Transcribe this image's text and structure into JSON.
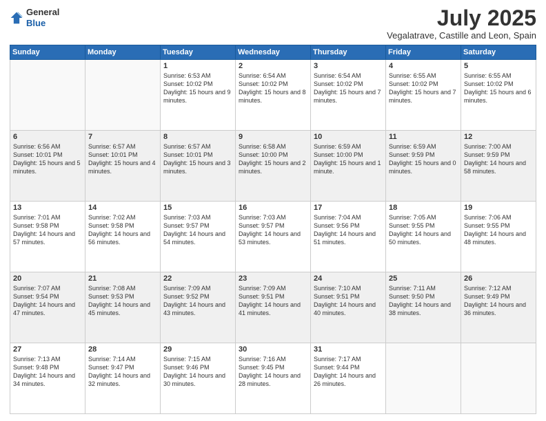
{
  "header": {
    "logo_line1": "General",
    "logo_line2": "Blue",
    "month": "July 2025",
    "location": "Vegalatrave, Castille and Leon, Spain"
  },
  "weekdays": [
    "Sunday",
    "Monday",
    "Tuesday",
    "Wednesday",
    "Thursday",
    "Friday",
    "Saturday"
  ],
  "weeks": [
    [
      {
        "day": "",
        "info": ""
      },
      {
        "day": "",
        "info": ""
      },
      {
        "day": "1",
        "info": "Sunrise: 6:53 AM\nSunset: 10:02 PM\nDaylight: 15 hours and 9 minutes."
      },
      {
        "day": "2",
        "info": "Sunrise: 6:54 AM\nSunset: 10:02 PM\nDaylight: 15 hours and 8 minutes."
      },
      {
        "day": "3",
        "info": "Sunrise: 6:54 AM\nSunset: 10:02 PM\nDaylight: 15 hours and 7 minutes."
      },
      {
        "day": "4",
        "info": "Sunrise: 6:55 AM\nSunset: 10:02 PM\nDaylight: 15 hours and 7 minutes."
      },
      {
        "day": "5",
        "info": "Sunrise: 6:55 AM\nSunset: 10:02 PM\nDaylight: 15 hours and 6 minutes."
      }
    ],
    [
      {
        "day": "6",
        "info": "Sunrise: 6:56 AM\nSunset: 10:01 PM\nDaylight: 15 hours and 5 minutes."
      },
      {
        "day": "7",
        "info": "Sunrise: 6:57 AM\nSunset: 10:01 PM\nDaylight: 15 hours and 4 minutes."
      },
      {
        "day": "8",
        "info": "Sunrise: 6:57 AM\nSunset: 10:01 PM\nDaylight: 15 hours and 3 minutes."
      },
      {
        "day": "9",
        "info": "Sunrise: 6:58 AM\nSunset: 10:00 PM\nDaylight: 15 hours and 2 minutes."
      },
      {
        "day": "10",
        "info": "Sunrise: 6:59 AM\nSunset: 10:00 PM\nDaylight: 15 hours and 1 minute."
      },
      {
        "day": "11",
        "info": "Sunrise: 6:59 AM\nSunset: 9:59 PM\nDaylight: 15 hours and 0 minutes."
      },
      {
        "day": "12",
        "info": "Sunrise: 7:00 AM\nSunset: 9:59 PM\nDaylight: 14 hours and 58 minutes."
      }
    ],
    [
      {
        "day": "13",
        "info": "Sunrise: 7:01 AM\nSunset: 9:58 PM\nDaylight: 14 hours and 57 minutes."
      },
      {
        "day": "14",
        "info": "Sunrise: 7:02 AM\nSunset: 9:58 PM\nDaylight: 14 hours and 56 minutes."
      },
      {
        "day": "15",
        "info": "Sunrise: 7:03 AM\nSunset: 9:57 PM\nDaylight: 14 hours and 54 minutes."
      },
      {
        "day": "16",
        "info": "Sunrise: 7:03 AM\nSunset: 9:57 PM\nDaylight: 14 hours and 53 minutes."
      },
      {
        "day": "17",
        "info": "Sunrise: 7:04 AM\nSunset: 9:56 PM\nDaylight: 14 hours and 51 minutes."
      },
      {
        "day": "18",
        "info": "Sunrise: 7:05 AM\nSunset: 9:55 PM\nDaylight: 14 hours and 50 minutes."
      },
      {
        "day": "19",
        "info": "Sunrise: 7:06 AM\nSunset: 9:55 PM\nDaylight: 14 hours and 48 minutes."
      }
    ],
    [
      {
        "day": "20",
        "info": "Sunrise: 7:07 AM\nSunset: 9:54 PM\nDaylight: 14 hours and 47 minutes."
      },
      {
        "day": "21",
        "info": "Sunrise: 7:08 AM\nSunset: 9:53 PM\nDaylight: 14 hours and 45 minutes."
      },
      {
        "day": "22",
        "info": "Sunrise: 7:09 AM\nSunset: 9:52 PM\nDaylight: 14 hours and 43 minutes."
      },
      {
        "day": "23",
        "info": "Sunrise: 7:09 AM\nSunset: 9:51 PM\nDaylight: 14 hours and 41 minutes."
      },
      {
        "day": "24",
        "info": "Sunrise: 7:10 AM\nSunset: 9:51 PM\nDaylight: 14 hours and 40 minutes."
      },
      {
        "day": "25",
        "info": "Sunrise: 7:11 AM\nSunset: 9:50 PM\nDaylight: 14 hours and 38 minutes."
      },
      {
        "day": "26",
        "info": "Sunrise: 7:12 AM\nSunset: 9:49 PM\nDaylight: 14 hours and 36 minutes."
      }
    ],
    [
      {
        "day": "27",
        "info": "Sunrise: 7:13 AM\nSunset: 9:48 PM\nDaylight: 14 hours and 34 minutes."
      },
      {
        "day": "28",
        "info": "Sunrise: 7:14 AM\nSunset: 9:47 PM\nDaylight: 14 hours and 32 minutes."
      },
      {
        "day": "29",
        "info": "Sunrise: 7:15 AM\nSunset: 9:46 PM\nDaylight: 14 hours and 30 minutes."
      },
      {
        "day": "30",
        "info": "Sunrise: 7:16 AM\nSunset: 9:45 PM\nDaylight: 14 hours and 28 minutes."
      },
      {
        "day": "31",
        "info": "Sunrise: 7:17 AM\nSunset: 9:44 PM\nDaylight: 14 hours and 26 minutes."
      },
      {
        "day": "",
        "info": ""
      },
      {
        "day": "",
        "info": ""
      }
    ]
  ]
}
